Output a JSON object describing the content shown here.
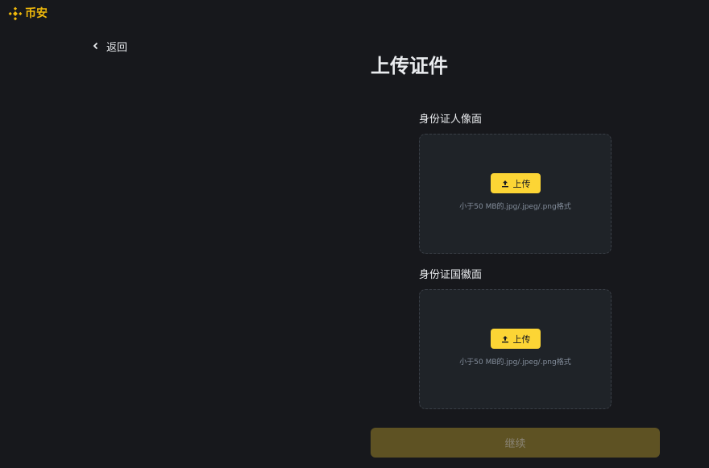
{
  "brand": {
    "logo_icon": "binance-logo-icon",
    "name": "币安",
    "color": "#f0b90b"
  },
  "nav": {
    "back_icon": "chevron-left-icon",
    "back_label": "返回"
  },
  "page": {
    "title": "上传证件"
  },
  "uploads": [
    {
      "label": "身份证人像面",
      "button_icon": "upload-icon",
      "button_label": "上传",
      "hint": "小于50 MB的.jpg/.jpeg/.png格式"
    },
    {
      "label": "身份证国徽面",
      "button_icon": "upload-icon",
      "button_label": "上传",
      "hint": "小于50 MB的.jpg/.jpeg/.png格式"
    }
  ],
  "actions": {
    "continue_label": "继续",
    "continue_disabled": true
  },
  "colors": {
    "background": "#17181c",
    "upload_box": "#1f2328",
    "accent": "#fcd535",
    "disabled_button": "#5e5223"
  }
}
